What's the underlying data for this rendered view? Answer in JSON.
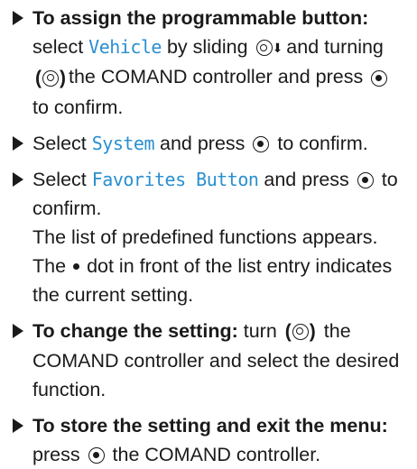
{
  "steps": [
    {
      "bold": "To assign the programmable button:",
      "t1": "select",
      "ui1": "Vehicle",
      "t2": "by sliding",
      "icon_slide": "slide-down-icon",
      "t3": "and turning",
      "icon_turn": "turn-controller-icon",
      "t4": "the COMAND controller and press",
      "icon_press": "press-controller-icon",
      "t5": "to confirm."
    },
    {
      "t1": "Select",
      "ui1": "System",
      "t2": "and press",
      "icon_press": "press-controller-icon",
      "t3": "to confirm."
    },
    {
      "t1": "Select",
      "ui1": "Favorites Button",
      "t2": "and press",
      "icon_press": "press-controller-icon",
      "t3": "to confirm.",
      "p1": "The list of predefined functions appears.",
      "p2a": "The",
      "p2b": "dot in front of the list entry indicates the current setting."
    },
    {
      "bold": "To change the setting:",
      "t1": "turn",
      "icon_turn": "turn-controller-icon",
      "t2": "the COMAND controller and select the desired function."
    },
    {
      "bold": "To store the setting and exit the menu:",
      "t1": "press",
      "icon_press": "press-controller-icon",
      "t2": "the COMAND controller."
    }
  ],
  "colors": {
    "ui_term": "#2a8fd0",
    "text": "#1a1a1a"
  }
}
